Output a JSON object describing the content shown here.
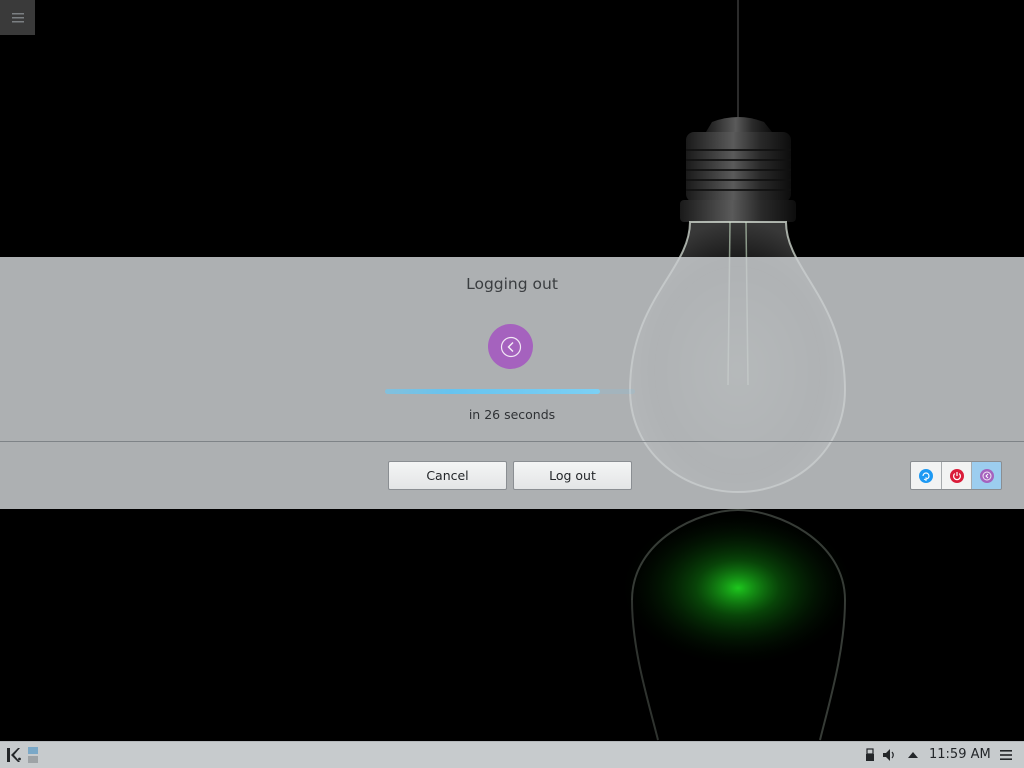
{
  "colors": {
    "accent_purple": "#a562be",
    "progress_blue": "#67c3ef",
    "panel_bg": "#cacdcf",
    "taskbar_bg": "#c7cbcd",
    "switch_user_blue": "#1d99f3",
    "shutdown_red": "#da1c3a"
  },
  "desktop": {
    "toolbox_icon": "hamburger-menu-icon"
  },
  "logout_dialog": {
    "title": "Logging out",
    "action_icon": "logout-arrow-icon",
    "progress_fraction": 0.86,
    "countdown_text": "in 26 seconds",
    "cancel_label": "Cancel",
    "confirm_label": "Log out",
    "modes": [
      {
        "name": "switch-user",
        "icon": "switch-user-icon",
        "selected": false
      },
      {
        "name": "shutdown",
        "icon": "power-icon",
        "selected": false
      },
      {
        "name": "logout",
        "icon": "logout-icon",
        "selected": true
      }
    ]
  },
  "taskbar": {
    "launcher_icon": "app-launcher-icon",
    "pager_icon": "virtual-desktop-pager-icon",
    "tray_icons": [
      "usb-device-icon",
      "volume-icon",
      "show-hidden-icons-arrow",
      "menu-icon"
    ],
    "clock": "11:59 AM"
  }
}
